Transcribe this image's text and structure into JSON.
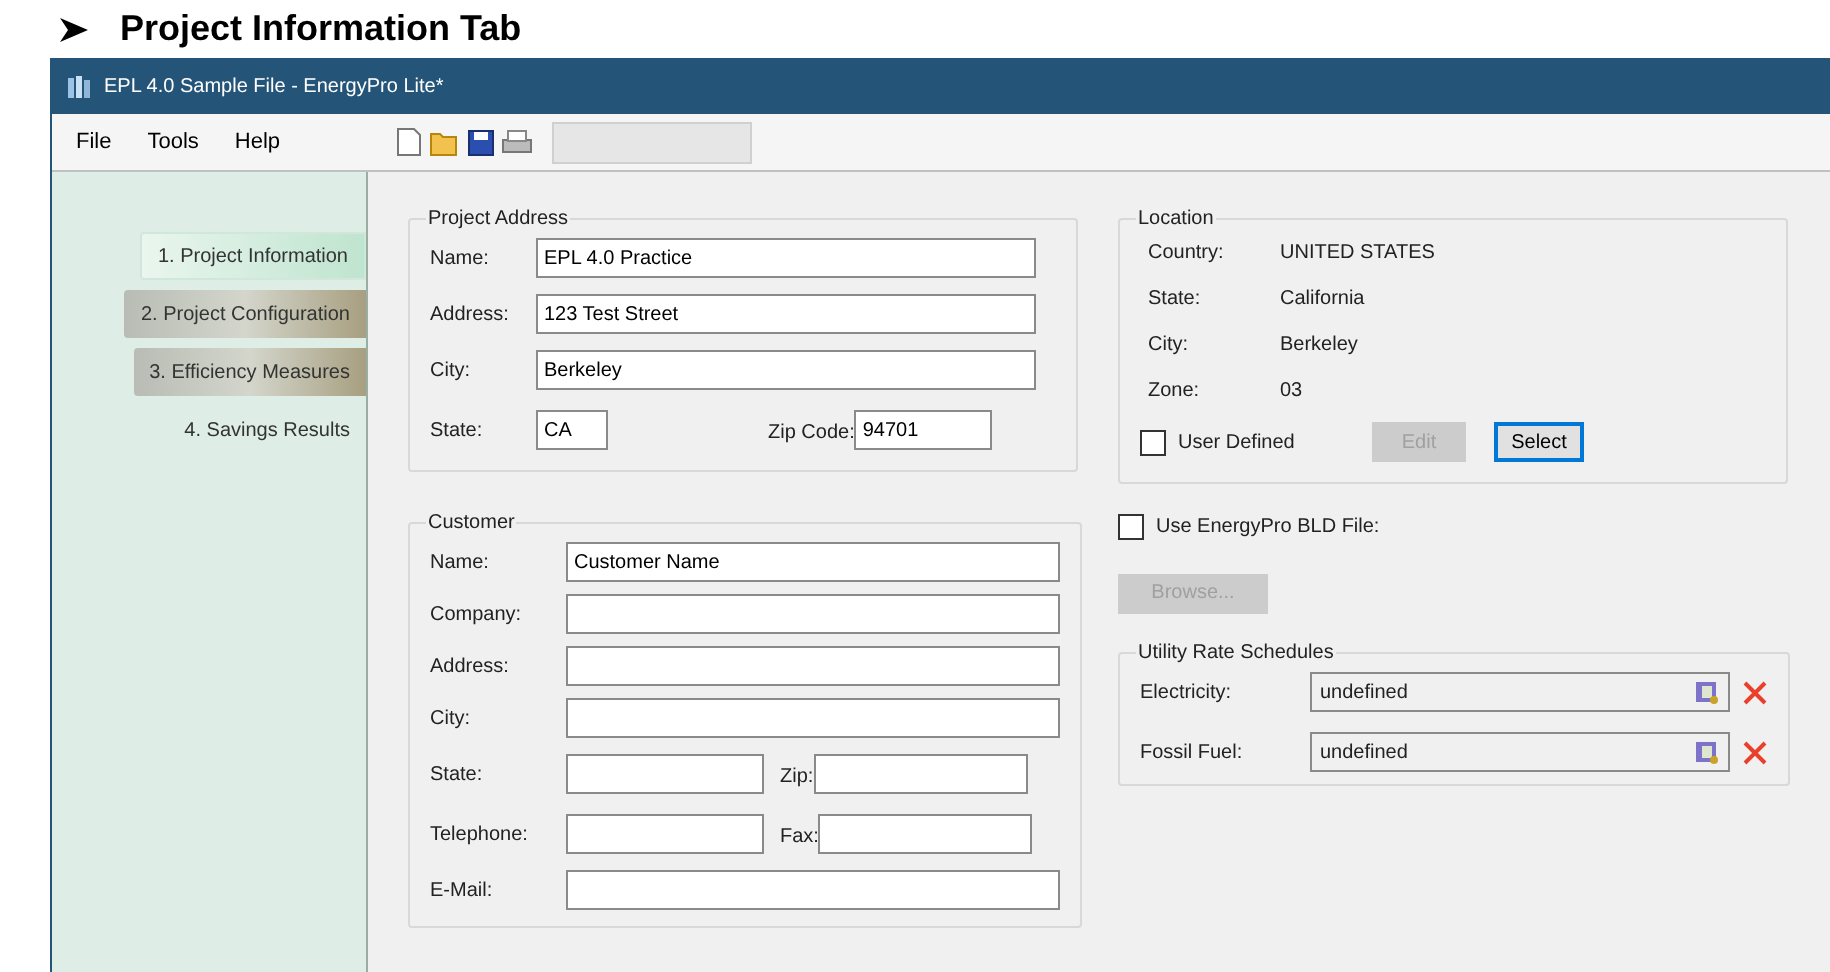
{
  "heading": "Project Information Tab",
  "window": {
    "title": "EPL 4.0 Sample File - EnergyPro Lite*"
  },
  "menu": [
    "File",
    "Tools",
    "Help"
  ],
  "sidebar": {
    "items": [
      {
        "label": "1. Project Information",
        "selected": true,
        "completed": false
      },
      {
        "label": "2. Project Configuration",
        "selected": false,
        "completed": true
      },
      {
        "label": "3. Efficiency Measures",
        "selected": false,
        "completed": true
      },
      {
        "label": "4. Savings Results",
        "selected": false,
        "completed": false
      }
    ]
  },
  "project_address": {
    "title": "Project Address",
    "fields": [
      {
        "label": "Name:",
        "value": "EPL 4.0 Practice"
      },
      {
        "label": "Address:",
        "value": "123 Test Street"
      },
      {
        "label": "City:",
        "value": "Berkeley"
      }
    ],
    "state": {
      "label": "State:",
      "value": "CA"
    },
    "zip": {
      "label": "Zip Code:",
      "value": "94701"
    }
  },
  "customer": {
    "title": "Customer",
    "fields": [
      {
        "label": "Name:",
        "value": "Customer Name"
      },
      {
        "label": "Company:"
      },
      {
        "label": "Address:"
      },
      {
        "label": "City:"
      }
    ],
    "pairs": [
      {
        "left": {
          "label": "State:"
        },
        "right": {
          "label": "Zip:"
        }
      },
      {
        "left": {
          "label": "Telephone:"
        },
        "right": {
          "label": "Fax:"
        }
      }
    ],
    "email": {
      "label": "E-Mail:"
    }
  },
  "location": {
    "title": "Location",
    "rows": [
      {
        "label": "Country:",
        "value": "UNITED STATES"
      },
      {
        "label": "State:",
        "value": "California"
      },
      {
        "label": "City:",
        "value": "Berkeley"
      },
      {
        "label": "Zone:",
        "value": "03"
      }
    ],
    "user_defined": {
      "label": "User Defined",
      "checked": false
    },
    "buttons": [
      {
        "label": "Edit",
        "disabled": true,
        "focused": false
      },
      {
        "label": "Select",
        "disabled": false,
        "focused": true
      }
    ]
  },
  "bld_file": {
    "label": "Use EnergyPro BLD File:",
    "checked": false,
    "browse": {
      "label": "Browse...",
      "disabled": true
    }
  },
  "utility": {
    "title": "Utility Rate Schedules",
    "rows": [
      {
        "label": "Electricity:",
        "value": "undefined"
      },
      {
        "label": "Fossil Fuel:",
        "value": "undefined"
      }
    ]
  }
}
